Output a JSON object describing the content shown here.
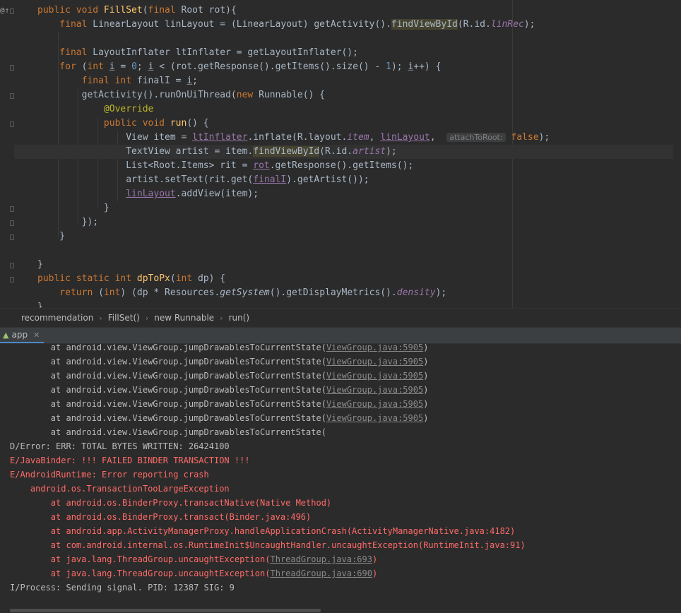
{
  "editor": {
    "lines": [
      [
        {
          "t": "public void ",
          "c": "kw"
        },
        {
          "t": "FillSet",
          "c": "fn"
        },
        {
          "t": "(",
          "c": ""
        },
        {
          "t": "final ",
          "c": "kw"
        },
        {
          "t": "Root rot){",
          "c": ""
        }
      ],
      [
        {
          "t": "    final ",
          "c": "kw"
        },
        {
          "t": "LinearLayout linLayout = (LinearLayout) getActivity().",
          "c": ""
        },
        {
          "t": "findViewById",
          "c": "hl"
        },
        {
          "t": "(R.id.",
          "c": ""
        },
        {
          "t": "linRec",
          "c": "fld"
        },
        {
          "t": ");",
          "c": ""
        }
      ],
      [],
      [
        {
          "t": "    final ",
          "c": "kw"
        },
        {
          "t": "LayoutInflater ltInflater = getLayoutInflater();",
          "c": ""
        }
      ],
      [
        {
          "t": "    for ",
          "c": "kw"
        },
        {
          "t": "(",
          "c": ""
        },
        {
          "t": "int ",
          "c": "kw"
        },
        {
          "t": "i",
          "c": "lv"
        },
        {
          "t": " = ",
          "c": ""
        },
        {
          "t": "0",
          "c": "num"
        },
        {
          "t": "; ",
          "c": ""
        },
        {
          "t": "i",
          "c": "lv"
        },
        {
          "t": " < (rot.getResponse().getItems().size() - ",
          "c": ""
        },
        {
          "t": "1",
          "c": "num"
        },
        {
          "t": "); ",
          "c": ""
        },
        {
          "t": "i",
          "c": "lv"
        },
        {
          "t": "++) {",
          "c": ""
        }
      ],
      [
        {
          "t": "        final int ",
          "c": "kw"
        },
        {
          "t": "finalI = ",
          "c": ""
        },
        {
          "t": "i",
          "c": "lv"
        },
        {
          "t": ";",
          "c": ""
        }
      ],
      [
        {
          "t": "        getActivity().runOnUiThread(",
          "c": ""
        },
        {
          "t": "new ",
          "c": "kw"
        },
        {
          "t": "Runnable() {",
          "c": ""
        }
      ],
      [
        {
          "t": "            @Override",
          "c": "ann"
        }
      ],
      [
        {
          "t": "            public void ",
          "c": "kw"
        },
        {
          "t": "run",
          "c": "fn"
        },
        {
          "t": "() {",
          "c": ""
        }
      ],
      [
        {
          "t": "                View item = ",
          "c": ""
        },
        {
          "t": "ltInflater",
          "c": "fldu"
        },
        {
          "t": ".inflate(R.layout.",
          "c": ""
        },
        {
          "t": "item",
          "c": "fld"
        },
        {
          "t": ", ",
          "c": ""
        },
        {
          "t": "linLayout",
          "c": "fldu"
        },
        {
          "t": ",  ",
          "c": ""
        },
        {
          "t": "attachToRoot:",
          "c": "hint"
        },
        {
          "t": " false",
          "c": "kw"
        },
        {
          "t": ");",
          "c": ""
        }
      ],
      [
        {
          "t": "                TextView artist = item.",
          "c": ""
        },
        {
          "t": "findViewById",
          "c": "hl"
        },
        {
          "t": "(R.id.",
          "c": ""
        },
        {
          "t": "artist",
          "c": "fld"
        },
        {
          "t": ");",
          "c": ""
        }
      ],
      [
        {
          "t": "                List<Root.Items> rit = ",
          "c": ""
        },
        {
          "t": "rot",
          "c": "fldu"
        },
        {
          "t": ".getResponse().getItems();",
          "c": ""
        }
      ],
      [
        {
          "t": "                artist.setText(rit.get(",
          "c": ""
        },
        {
          "t": "finalI",
          "c": "fldu"
        },
        {
          "t": ").getArtist());",
          "c": ""
        }
      ],
      [
        {
          "t": "                ",
          "c": ""
        },
        {
          "t": "linLayout",
          "c": "fldu"
        },
        {
          "t": ".addView(item);",
          "c": ""
        }
      ],
      [
        {
          "t": "            }",
          "c": ""
        }
      ],
      [
        {
          "t": "        });",
          "c": ""
        }
      ],
      [
        {
          "t": "    }",
          "c": ""
        }
      ],
      [],
      [
        {
          "t": "}",
          "c": ""
        }
      ],
      [
        {
          "t": "public static int ",
          "c": "kw"
        },
        {
          "t": "dpToPx",
          "c": "fn"
        },
        {
          "t": "(",
          "c": ""
        },
        {
          "t": "int ",
          "c": "kw"
        },
        {
          "t": "dp) {",
          "c": ""
        }
      ],
      [
        {
          "t": "    return ",
          "c": "kw"
        },
        {
          "t": "(",
          "c": ""
        },
        {
          "t": "int",
          "c": "kw"
        },
        {
          "t": ") (dp * Resources.",
          "c": ""
        },
        {
          "t": "getSystem",
          "c": "italic"
        },
        {
          "t": "().getDisplayMetrics().",
          "c": ""
        },
        {
          "t": "density",
          "c": "fld"
        },
        {
          "t": ");",
          "c": ""
        }
      ],
      [
        {
          "t": "}",
          "c": ""
        }
      ]
    ],
    "current_line": 10
  },
  "breadcrumb": [
    "recommendation",
    "FillSet()",
    "new Runnable",
    "run()"
  ],
  "run_tab": {
    "label": "app"
  },
  "console": {
    "lines": [
      {
        "t": "        at android.view.ViewGroup.jumpDrawablesToCurrentState(",
        "link": "ViewGroup.java:5905",
        "end": ")",
        "c": ""
      },
      {
        "t": "        at android.view.ViewGroup.jumpDrawablesToCurrentState(",
        "link": "ViewGroup.java:5905",
        "end": ")",
        "c": ""
      },
      {
        "t": "        at android.view.ViewGroup.jumpDrawablesToCurrentState(",
        "link": "ViewGroup.java:5905",
        "end": ")",
        "c": ""
      },
      {
        "t": "        at android.view.ViewGroup.jumpDrawablesToCurrentState(",
        "link": "ViewGroup.java:5905",
        "end": ")",
        "c": ""
      },
      {
        "t": "        at android.view.ViewGroup.jumpDrawablesToCurrentState(",
        "link": "ViewGroup.java:5905",
        "end": ")",
        "c": ""
      },
      {
        "t": "        at android.view.ViewGroup.jumpDrawablesToCurrentState(",
        "link": "ViewGroup.java:5905",
        "end": ")",
        "c": ""
      },
      {
        "t": "        at android.view.ViewGroup.jumpDrawablesToCurrentState(",
        "link": "",
        "end": "",
        "c": ""
      },
      {
        "t": "D/Error: ERR: TOTAL BYTES WRITTEN: 26424100",
        "link": "",
        "end": "",
        "c": ""
      },
      {
        "t": "E/JavaBinder: !!! FAILED BINDER TRANSACTION !!!",
        "link": "",
        "end": "",
        "c": "err"
      },
      {
        "t": "E/AndroidRuntime: Error reporting crash",
        "link": "",
        "end": "",
        "c": "err"
      },
      {
        "t": "    android.os.TransactionTooLargeException",
        "link": "",
        "end": "",
        "c": "err"
      },
      {
        "t": "        at android.os.BinderProxy.transactNative(Native Method)",
        "link": "",
        "end": "",
        "c": "err"
      },
      {
        "t": "        at android.os.BinderProxy.transact(Binder.java:496)",
        "link": "",
        "end": "",
        "c": "err"
      },
      {
        "t": "        at android.app.ActivityManagerProxy.handleApplicationCrash(ActivityManagerNative.java:4182)",
        "link": "",
        "end": "",
        "c": "err"
      },
      {
        "t": "        at com.android.internal.os.RuntimeInit$UncaughtHandler.uncaughtException(RuntimeInit.java:91)",
        "link": "",
        "end": "",
        "c": "err"
      },
      {
        "t": "        at java.lang.ThreadGroup.uncaughtException(",
        "link": "ThreadGroup.java:693",
        "end": ")",
        "c": "err"
      },
      {
        "t": "        at java.lang.ThreadGroup.uncaughtException(",
        "link": "ThreadGroup.java:690",
        "end": ")",
        "c": "err"
      },
      {
        "t": "I/Process: Sending signal. PID: 12387 SIG: 9",
        "link": "",
        "end": "",
        "c": ""
      }
    ]
  },
  "colors": {
    "background": "#2b2b2b",
    "keyword": "#cc7832",
    "error": "#ff6b68",
    "accent": "#4a88c7"
  }
}
